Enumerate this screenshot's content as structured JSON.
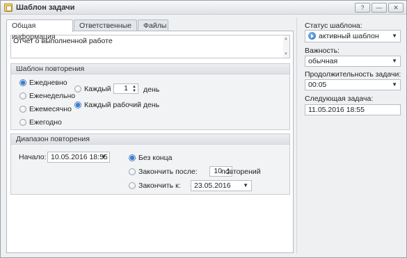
{
  "window": {
    "title": "Шаблон задачи",
    "buttons": {
      "help": "?",
      "minimize": "—",
      "close": "✕"
    }
  },
  "tabs": [
    {
      "label": "Общая информация",
      "active": true
    },
    {
      "label": "Ответственные лица",
      "active": false
    },
    {
      "label": "Файлы",
      "active": false
    }
  ],
  "description": {
    "value": "Отчет о выполненной работе"
  },
  "recurrence": {
    "title": "Шаблон повторения",
    "options": [
      "Ежедневно",
      "Еженедельно",
      "Ежемесячно",
      "Ежегодно"
    ],
    "selected": "Ежедневно",
    "every_label": "Каждый",
    "every_value": "1",
    "day_label": "день",
    "every_workday_label": "Каждый рабочий день",
    "workday_selected": true
  },
  "range": {
    "title": "Диапазон повторения",
    "start_label": "Начало:",
    "start_value": "10.05.2016 18:55",
    "no_end_label": "Без конца",
    "end_after_label": "Закончить после:",
    "end_after_value": "10",
    "occurrences_label": "повторений",
    "end_by_label": "Закончить к:",
    "end_by_value": "23.05.2016",
    "selected": "Без конца"
  },
  "side": {
    "status_label": "Статус шаблона:",
    "status_value": "активный шаблон",
    "importance_label": "Важность:",
    "importance_value": "обычная",
    "duration_label": "Продолжительность задачи:",
    "duration_value": "00:05",
    "next_label": "Следующая задача:",
    "next_value": "11.05.2016 18:55"
  },
  "colors": {
    "accent": "#3a7ed6",
    "window_bg": "#eef0f2"
  },
  "icons": [
    "template-icon",
    "help-icon",
    "minimize-icon",
    "close-icon",
    "chevron-down-icon",
    "spin-arrows-icon",
    "play-status-icon"
  ]
}
